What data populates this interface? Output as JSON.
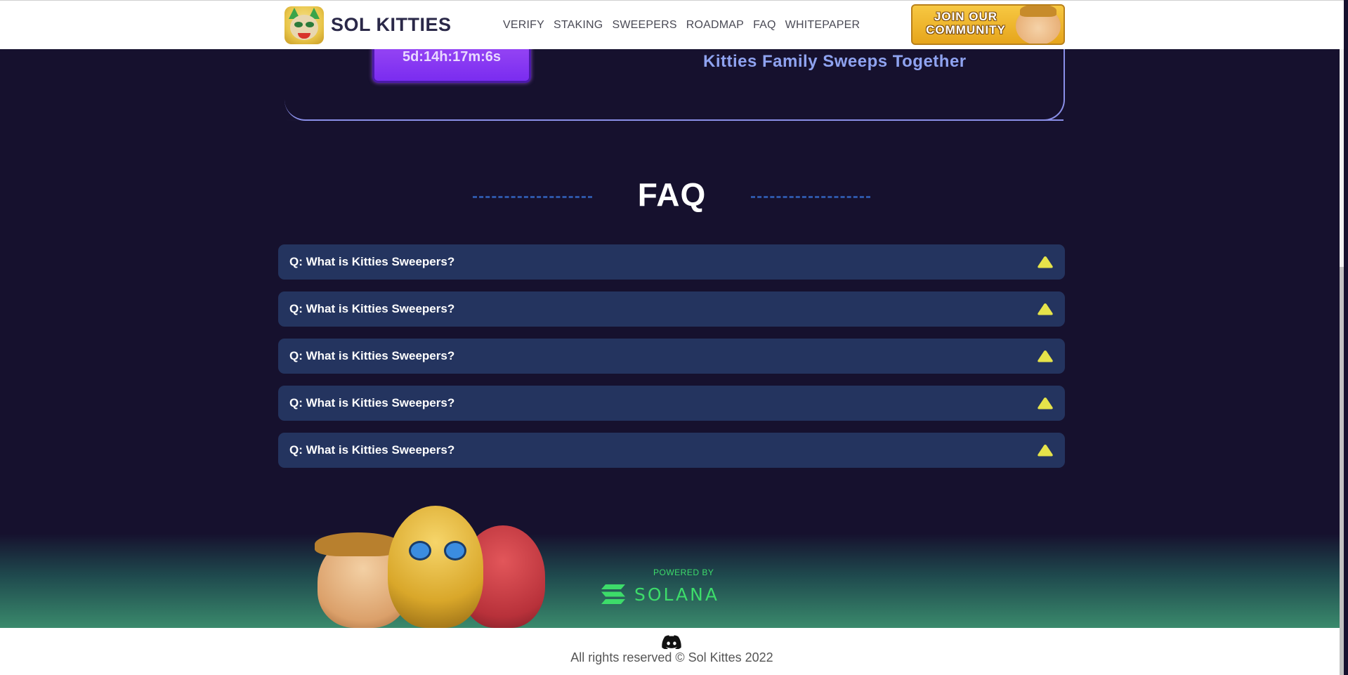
{
  "header": {
    "brand_name": "SOL KITTIES",
    "nav": [
      "VERIFY",
      "STAKING",
      "SWEEPERS",
      "ROADMAP",
      "FAQ",
      "WHITEPAPER"
    ],
    "join_label_line1": "JOIN OUR",
    "join_label_line2": "COMMUNITY"
  },
  "hero": {
    "countdown": "5d:14h:17m:6s",
    "tagline": "Kitties Family Sweeps Together"
  },
  "faq": {
    "title": "FAQ",
    "items": [
      {
        "question": "Q: What is Kitties Sweepers?"
      },
      {
        "question": "Q: What is Kitties Sweepers?"
      },
      {
        "question": "Q: What is Kitties Sweepers?"
      },
      {
        "question": "Q: What is Kitties Sweepers?"
      },
      {
        "question": "Q: What is Kitties Sweepers?"
      }
    ],
    "toggle_icon": "triangle-up-icon",
    "toggle_color": "#e6e34a"
  },
  "footer": {
    "powered_by": "POWERED BY",
    "solana": "SOLANA",
    "copyright": "All rights reserved © Sol Kittes 2022",
    "social_icon": "discord-icon"
  },
  "colors": {
    "background": "#16112e",
    "faq_item_bg": "#24345f",
    "accent_purple": "#8a3ff2",
    "solana_green": "#3ddc6a",
    "tagline_blue": "#8fa3f0"
  }
}
